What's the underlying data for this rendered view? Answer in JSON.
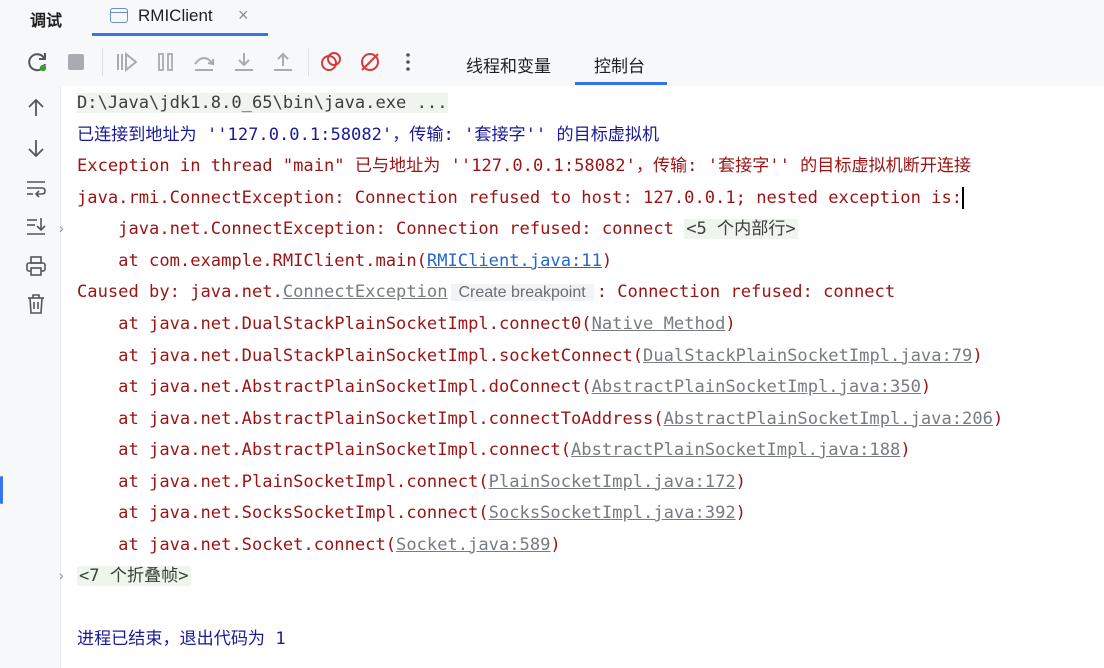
{
  "top": {
    "title": "调试",
    "tab_label": "RMIClient",
    "tab_close": "×"
  },
  "toolbar": {
    "buttons": [
      "rerun-icon",
      "stop-icon",
      "resume-icon",
      "pause-icon",
      "step-over-icon",
      "step-into-icon",
      "step-out-icon",
      "view-breakpoints-icon",
      "mute-breakpoints-icon",
      "more-icon"
    ],
    "tab_threads": "线程和变量",
    "tab_console": "控制台",
    "accent": "#3574f0"
  },
  "gutter": {
    "icons": [
      "arrow-up-icon",
      "arrow-down-icon",
      "soft-wrap-icon",
      "scroll-to-end-icon",
      "print-icon",
      "trash-icon"
    ]
  },
  "console": {
    "cmd": "D:\\Java\\jdk1.8.0_65\\bin\\java.exe ...",
    "connected": "已连接到地址为 ''127.0.0.1:58082'，传输: '套接字'' 的目标虚拟机",
    "exc_thread": "Exception in thread \"main\" 已与地址为 ''127.0.0.1:58082'，传输: '套接字'' 的目标虚拟机断开连接",
    "rmi_exc": "java.rmi.ConnectException: Connection refused to host: 127.0.0.1; nested exception is:",
    "net_exc_prefix": "    java.net.ConnectException: Connection refused: connect ",
    "inner_frames": "<5 个内部行>",
    "main_prefix": "    at com.example.RMIClient.main(",
    "main_link": "RMIClient.java:11",
    "caused_prefix": "Caused by: java.net.",
    "caused_link": "ConnectException",
    "bp_hint": "Create breakpoint",
    "caused_suffix": ": Connection refused: connect",
    "frames": [
      {
        "prefix": "    at java.net.DualStackPlainSocketImpl.connect0(",
        "link": "Native Method"
      },
      {
        "prefix": "    at java.net.DualStackPlainSocketImpl.socketConnect(",
        "link": "DualStackPlainSocketImpl.java:79"
      },
      {
        "prefix": "    at java.net.AbstractPlainSocketImpl.doConnect(",
        "link": "AbstractPlainSocketImpl.java:350"
      },
      {
        "prefix": "    at java.net.AbstractPlainSocketImpl.connectToAddress(",
        "link": "AbstractPlainSocketImpl.java:206"
      },
      {
        "prefix": "    at java.net.AbstractPlainSocketImpl.connect(",
        "link": "AbstractPlainSocketImpl.java:188"
      },
      {
        "prefix": "    at java.net.PlainSocketImpl.connect(",
        "link": "PlainSocketImpl.java:172"
      },
      {
        "prefix": "    at java.net.SocksSocketImpl.connect(",
        "link": "SocksSocketImpl.java:392"
      },
      {
        "prefix": "    at java.net.Socket.connect(",
        "link": "Socket.java:589"
      }
    ],
    "folded": "<7 个折叠帧>",
    "exit_prefix": "进程已结束，退出代码为 ",
    "exit_code": "1",
    "close_paren": ")"
  }
}
